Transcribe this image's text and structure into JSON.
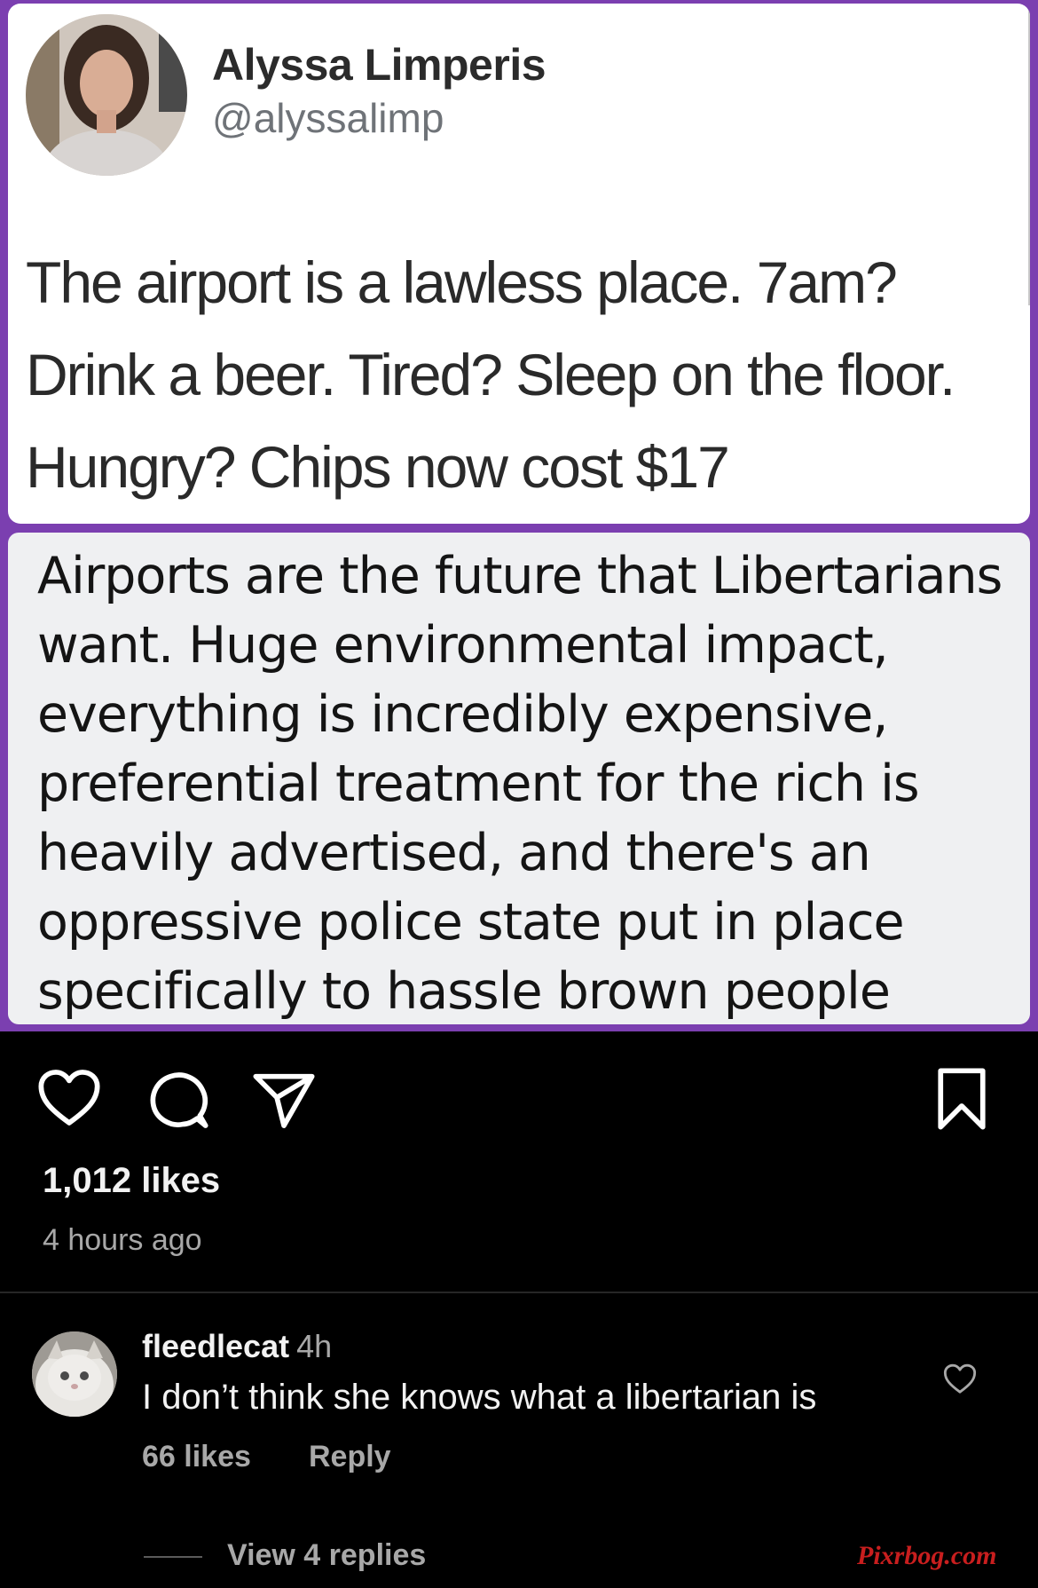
{
  "post": {
    "tweet": {
      "name": "Alyssa Limperis",
      "handle": "@alyssalimp",
      "text": "The airport is a lawless place. 7am?\nDrink a beer. Tired? Sleep on the floor.\nHungry? Chips now cost $17"
    },
    "reply_text": "Airports are the future that Libertarians want. Huge environmental impact, everything is incredibly expensive, preferential treatment for the rich is heavily advertised, and there's an oppressive police state put in place specifically to hassle brown people",
    "colors": {
      "frame": "#7b3fb0",
      "tweet_bg": "#ffffff",
      "reply_bg": "#eff0f2"
    }
  },
  "actions": {
    "icons": [
      "heart-icon",
      "comment-icon",
      "share-icon",
      "bookmark-icon"
    ]
  },
  "stats": {
    "likes": "1,012 likes",
    "time": "4 hours ago"
  },
  "comment": {
    "username": "fleedlecat",
    "time": "4h",
    "text": "I don’t think she knows what a libertarian is",
    "likes": "66 likes",
    "reply_label": "Reply",
    "view_replies": "View 4 replies"
  },
  "watermark": "Pixrbog.com"
}
